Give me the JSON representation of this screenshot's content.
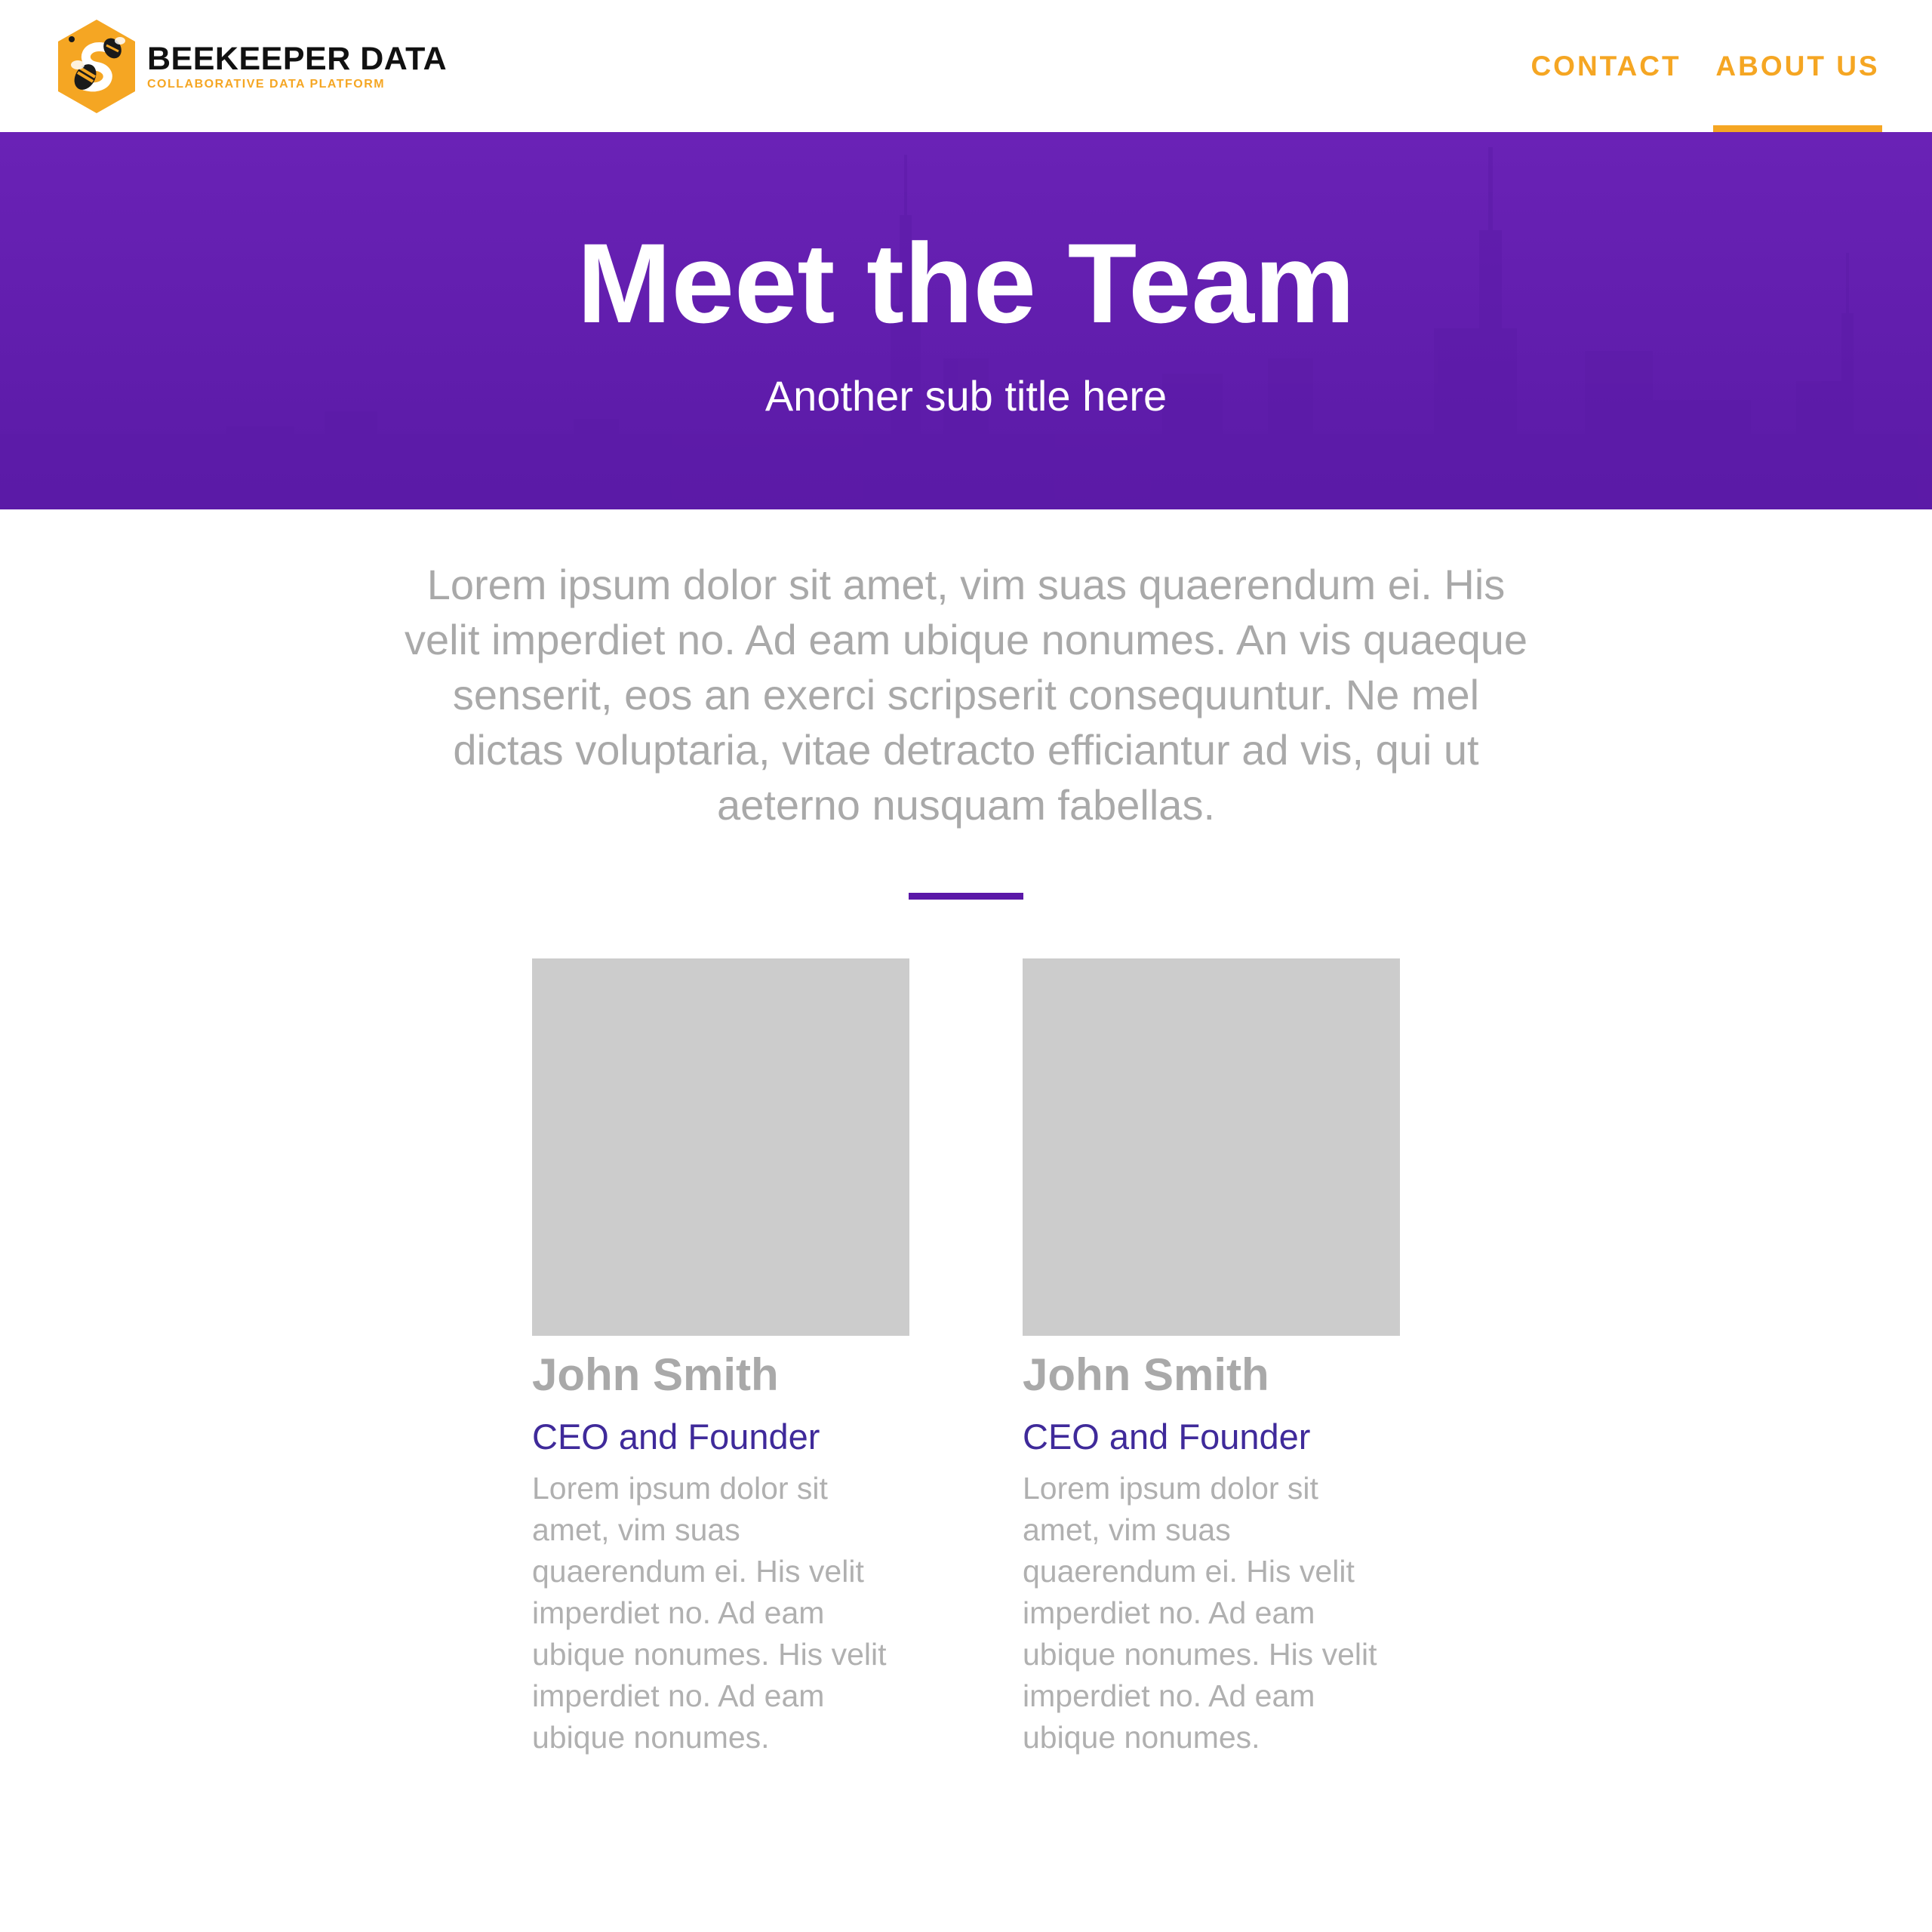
{
  "colors": {
    "accent": "#f5a623",
    "hero_bg": "#6a22b6",
    "divider": "#5b18a8",
    "role_text": "#3f2a9a",
    "muted_text": "#a9a9a9",
    "photo_placeholder": "#cccccc"
  },
  "brand": {
    "title": "BEEKEEPER DATA",
    "tagline": "COLLABORATIVE DATA PLATFORM",
    "logo_icon": "bee-hexagon-logo"
  },
  "nav": {
    "items": [
      {
        "label": "CONTACT",
        "active": false
      },
      {
        "label": "ABOUT US",
        "active": true
      }
    ]
  },
  "hero": {
    "title": "Meet the Team",
    "subtitle": "Another sub title here"
  },
  "intro": {
    "text": "Lorem ipsum dolor sit amet, vim suas quaerendum ei. His velit imperdiet no. Ad eam ubique nonumes. An vis quaeque senserit, eos an exerci scripserit consequuntur. Ne mel dictas voluptaria, vitae detracto efficiantur ad vis, qui ut aeterno nusquam fabellas."
  },
  "team": [
    {
      "name": "John Smith",
      "role": "CEO and Founder",
      "bio": "Lorem ipsum dolor sit amet, vim suas quaerendum ei. His velit imperdiet no. Ad eam ubique nonumes. His velit imperdiet no. Ad eam ubique nonumes."
    },
    {
      "name": "John Smith",
      "role": "CEO and Founder",
      "bio": "Lorem ipsum dolor sit amet, vim suas quaerendum ei. His velit imperdiet no. Ad eam ubique nonumes. His velit imperdiet no. Ad eam ubique nonumes."
    }
  ]
}
